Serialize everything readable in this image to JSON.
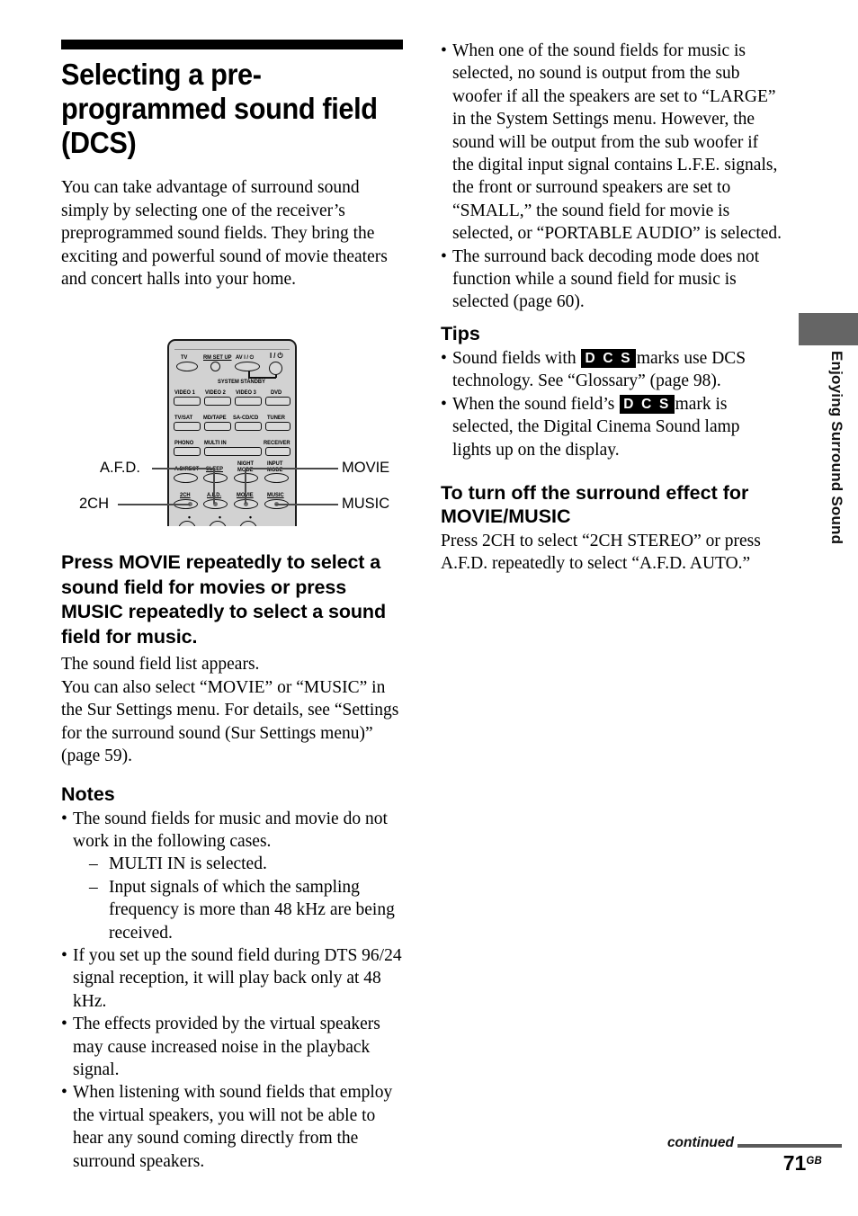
{
  "page": {
    "title": "Selecting a pre-programmed sound field (DCS)",
    "intro": "You can take advantage of surround sound simply by selecting one of the receiver’s preprogrammed sound fields. They bring the exciting and powerful sound of movie theaters and concert halls into your home."
  },
  "step": {
    "heading": "Press MOVIE repeatedly to select a sound field for movies or press MUSIC repeatedly to select a sound field for music.",
    "body_line_1": "The sound field list appears.",
    "body_line_2": "You can also select “MOVIE” or “MUSIC” in the Sur Settings menu. For details, see “Settings for the surround sound (Sur Settings menu)” (page 59)."
  },
  "notes": {
    "heading": "Notes",
    "items": [
      "The sound fields for music and movie do not work in the following cases.",
      "If you set up the sound field during DTS 96/24 signal reception, it will play back only at 48 kHz.",
      "The effects provided by the virtual speakers may cause increased noise in the playback signal.",
      "When listening with sound fields that employ the virtual speakers, you will not be able to hear any sound coming directly from the surround speakers."
    ],
    "sub_items": [
      "MULTI IN is selected.",
      "Input signals of which the sampling frequency is more than 48 kHz are being received."
    ]
  },
  "right_notes": {
    "items": [
      "When one of the sound fields for music is selected, no sound is output from the sub woofer if all the speakers are set to “LARGE” in the System Settings menu. However, the sound will be output from the sub woofer if the digital input signal contains L.F.E. signals, the front or surround speakers are set to “SMALL,” the sound field for movie is selected, or “PORTABLE AUDIO” is selected.",
      "The surround back decoding mode does not function while a sound field for music is selected (page 60)."
    ]
  },
  "tips": {
    "heading": "Tips",
    "badge": "D C S",
    "item_1_before": "Sound fields with ",
    "item_1_after": "marks use DCS technology. See “Glossary” (page 98).",
    "item_2_before": "When the sound field’s ",
    "item_2_after": "mark is selected, the Digital Cinema Sound lamp lights up on the display."
  },
  "turn_off": {
    "heading": "To turn off the surround effect for MOVIE/MUSIC",
    "body": "Press 2CH to select “2CH STEREO” or press A.F.D. repeatedly to select “A.F.D. AUTO.”"
  },
  "remote": {
    "callouts": {
      "left_top": "A.F.D.",
      "left_bottom": "2CH",
      "right_top": "MOVIE",
      "right_bottom": "MUSIC"
    },
    "buttons": {
      "tv": "TV",
      "rm_set_up": "RM SET UP",
      "av_power": "AV I / ⏻",
      "main_power": "I / ⏻",
      "system_standby": "SYSTEM STANDBY",
      "video1": "VIDEO 1",
      "video2": "VIDEO 2",
      "video3": "VIDEO 3",
      "dvd": "DVD",
      "tv_sat": "TV/SAT",
      "md_tape": "MD/TAPE",
      "sa_cd_cd": "SA-CD/CD",
      "tuner": "TUNER",
      "phono": "PHONO",
      "multi_in": "MULTI IN",
      "receiver": "RECEIVER",
      "a_direct": "A.DIRECT",
      "sleep": "SLEEP",
      "night_mode": "NIGHT MODE",
      "input_mode": "INPUT MODE",
      "two_ch": "2CH",
      "afd": "A.F.D.",
      "movie": "MOVIE",
      "music": "MUSIC"
    }
  },
  "side_tab": {
    "label": "Enjoying Surround Sound",
    "color": "#656565"
  },
  "footer": {
    "continued": "continued",
    "page_number": "71",
    "page_suffix": "GB"
  }
}
